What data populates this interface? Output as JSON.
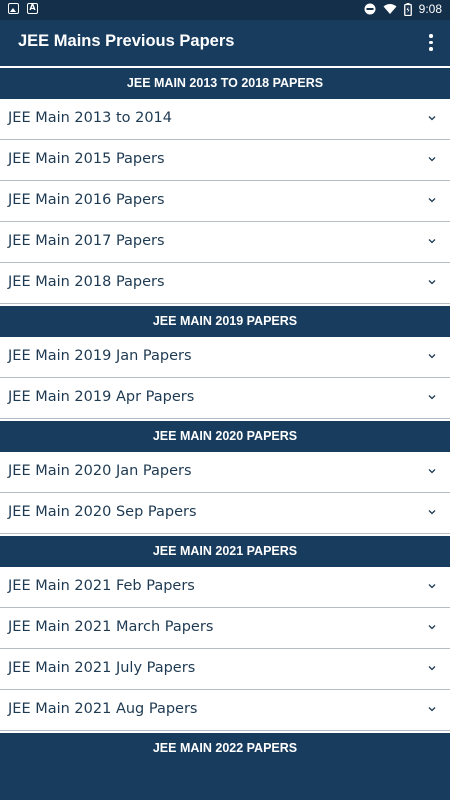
{
  "status_bar": {
    "time": "9:08",
    "icons": [
      "image-notification-icon",
      "a-notification-icon",
      "do-not-disturb-icon",
      "wifi-icon",
      "battery-icon"
    ]
  },
  "app_bar": {
    "title": "JEE Mains Previous Papers",
    "menu_icon": "more-vert-icon"
  },
  "sections": [
    {
      "header": "JEE MAIN 2013 TO 2018 PAPERS",
      "items": [
        {
          "label": "JEE Main 2013 to 2014"
        },
        {
          "label": "JEE Main 2015 Papers"
        },
        {
          "label": "JEE Main 2016 Papers"
        },
        {
          "label": "JEE Main 2017 Papers"
        },
        {
          "label": "JEE Main 2018 Papers"
        }
      ]
    },
    {
      "header": "JEE MAIN 2019 PAPERS",
      "items": [
        {
          "label": "JEE Main 2019 Jan Papers"
        },
        {
          "label": "JEE Main 2019 Apr Papers"
        }
      ]
    },
    {
      "header": "JEE MAIN 2020 PAPERS",
      "items": [
        {
          "label": "JEE Main 2020 Jan Papers"
        },
        {
          "label": "JEE Main 2020 Sep Papers"
        }
      ]
    },
    {
      "header": "JEE MAIN 2021 PAPERS",
      "items": [
        {
          "label": "JEE Main 2021 Feb Papers"
        },
        {
          "label": "JEE Main 2021 March Papers"
        },
        {
          "label": "JEE Main 2021 July Papers"
        },
        {
          "label": "JEE Main 2021 Aug Papers"
        }
      ]
    },
    {
      "header": "JEE MAIN 2022 PAPERS",
      "items": []
    }
  ],
  "colors": {
    "primary": "#183c5e",
    "status_bar": "#142f4a",
    "item_background": "#ffffff",
    "item_text": "#1e3a52",
    "divider": "#b5bcc4"
  }
}
